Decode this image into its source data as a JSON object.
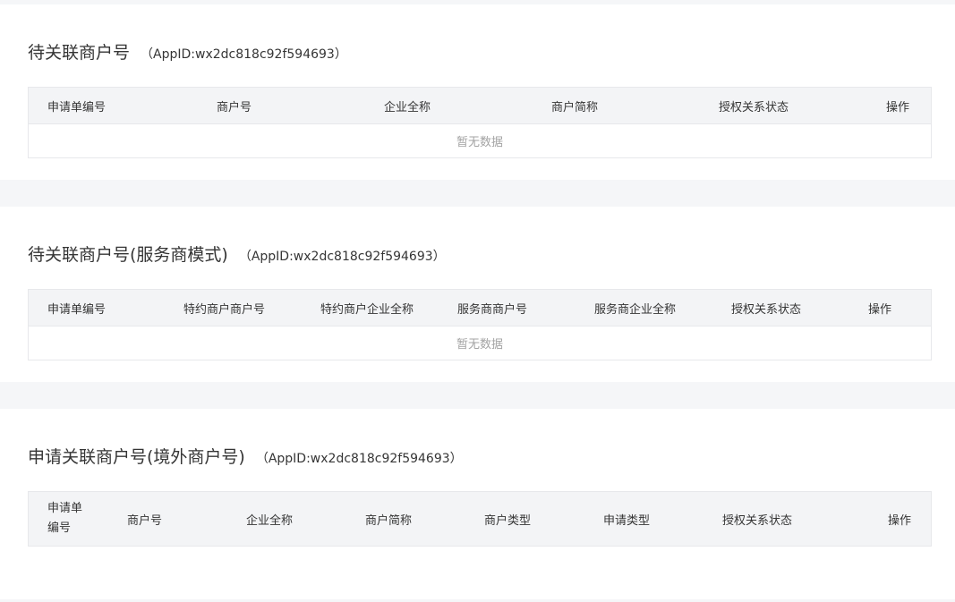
{
  "sections": [
    {
      "title": "待关联商户号",
      "appid": "（AppID:wx2dc818c92f594693）",
      "columns": [
        "申请单编号",
        "商户号",
        "企业全称",
        "商户简称",
        "授权关系状态",
        "操作"
      ],
      "empty_text": "暂无数据"
    },
    {
      "title": "待关联商户号(服务商模式)",
      "appid": "（AppID:wx2dc818c92f594693）",
      "columns": [
        "申请单编号",
        "特约商户商户号",
        "特约商户企业全称",
        "服务商商户号",
        "服务商企业全称",
        "授权关系状态",
        "操作"
      ],
      "empty_text": "暂无数据"
    },
    {
      "title": "申请关联商户号(境外商户号)",
      "appid": "（AppID:wx2dc818c92f594693）",
      "columns": [
        "申请单编号",
        "商户号",
        "企业全称",
        "商户简称",
        "商户类型",
        "申请类型",
        "授权关系状态",
        "操作"
      ]
    }
  ]
}
